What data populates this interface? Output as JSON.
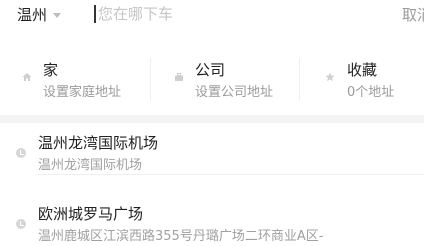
{
  "header": {
    "city": "温州",
    "search_placeholder": "您在哪下车",
    "cancel_label": "取消"
  },
  "quick_places": [
    {
      "title": "家",
      "subtitle": "设置家庭地址",
      "icon": "home-icon"
    },
    {
      "title": "公司",
      "subtitle": "设置公司地址",
      "icon": "briefcase-icon"
    },
    {
      "title": "收藏",
      "subtitle": "0个地址",
      "icon": "star-icon"
    }
  ],
  "history": [
    {
      "title": "温州龙湾国际机场",
      "address": "温州龙湾国际机场",
      "icon": "clock-icon"
    },
    {
      "title": "欧洲城罗马广场",
      "address": "温州鹿城区江滨西路355号丹璐广场二环商业A区-",
      "icon": "clock-icon"
    }
  ]
}
